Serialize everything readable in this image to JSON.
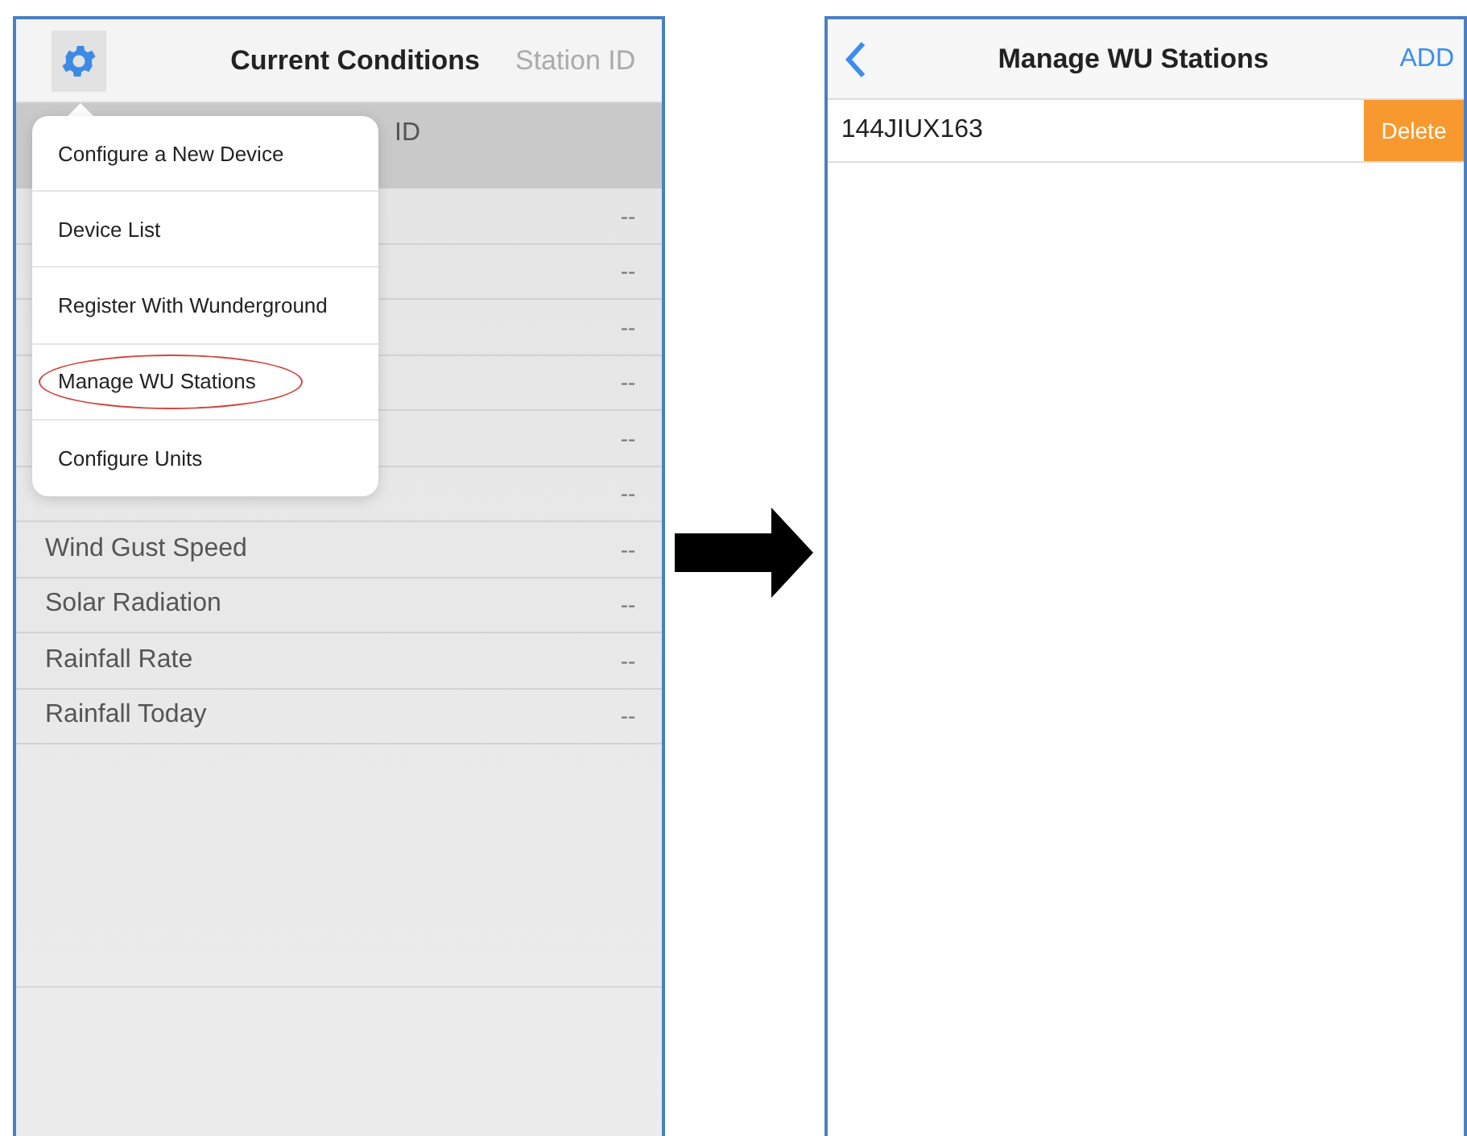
{
  "left_screen": {
    "title": "Current Conditions",
    "header_link": "Station ID",
    "band_text": "ID",
    "rows": [
      {
        "label": "",
        "value": "--"
      },
      {
        "label": "",
        "value": "--"
      },
      {
        "label": "",
        "value": "--"
      },
      {
        "label": "",
        "value": "--"
      },
      {
        "label": "",
        "value": "--"
      },
      {
        "label": "",
        "value": "--"
      },
      {
        "label": "Wind Gust Speed",
        "value": "--"
      },
      {
        "label": "Solar Radiation",
        "value": "--"
      },
      {
        "label": "Rainfall Rate",
        "value": "--"
      },
      {
        "label": "Rainfall Today",
        "value": "--"
      }
    ],
    "menu": [
      {
        "label": "Configure a New Device",
        "circled": false
      },
      {
        "label": "Device List",
        "circled": false
      },
      {
        "label": "Register With Wunderground",
        "circled": false
      },
      {
        "label": "Manage WU Stations",
        "circled": true
      },
      {
        "label": "Configure Units",
        "circled": false
      }
    ]
  },
  "right_screen": {
    "title": "Manage WU Stations",
    "action": "ADD",
    "stations": [
      {
        "id": "144JIUX163",
        "delete_label": "Delete"
      }
    ]
  }
}
